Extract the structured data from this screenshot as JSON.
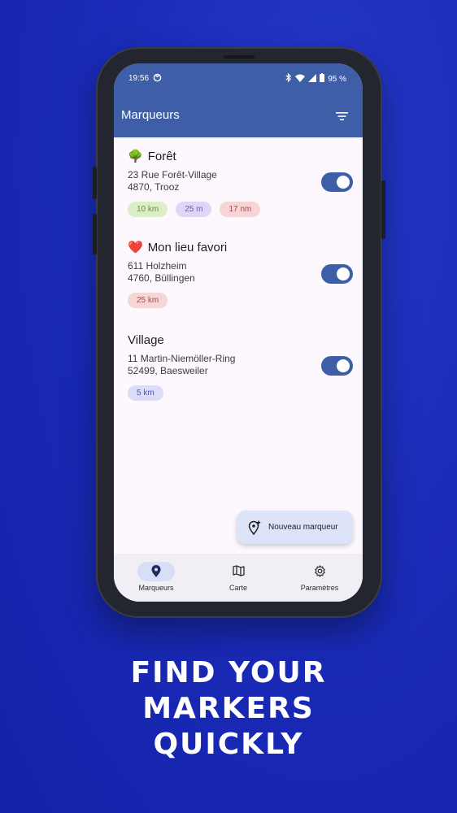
{
  "status": {
    "time": "19:56",
    "battery": "95 %"
  },
  "appbar": {
    "title": "Marqueurs"
  },
  "markers": [
    {
      "emoji": "🌳",
      "name": "Forêt",
      "addr1": "23 Rue Forêt-Village",
      "addr2": "4870, Trooz",
      "chips": [
        {
          "label": "10 km",
          "bg": "#dbeec6",
          "fg": "#6b8a38"
        },
        {
          "label": "25 m",
          "bg": "#ddd7f5",
          "fg": "#6a54b8"
        },
        {
          "label": "17 nm",
          "bg": "#f5d5d5",
          "fg": "#b04545"
        }
      ]
    },
    {
      "emoji": "❤️",
      "name": "Mon lieu favori",
      "addr1": "611 Holzheim",
      "addr2": "4760, Büllingen",
      "chips": [
        {
          "label": "25 km",
          "bg": "#f5d5d5",
          "fg": "#b04545"
        }
      ]
    },
    {
      "emoji": "",
      "name": "Village",
      "addr1": "11 Martin-Niemöller-Ring",
      "addr2": "52499, Baesweiler",
      "chips": [
        {
          "label": "5 km",
          "bg": "#dcdcf7",
          "fg": "#4e52b8"
        }
      ]
    }
  ],
  "fab": {
    "label": "Nouveau marqueur"
  },
  "nav": {
    "markers": "Marqueurs",
    "map": "Carte",
    "settings": "Paramètres"
  },
  "headline": {
    "line1": "FIND YOUR",
    "line2": "MARKERS",
    "line3": "QUICKLY"
  }
}
